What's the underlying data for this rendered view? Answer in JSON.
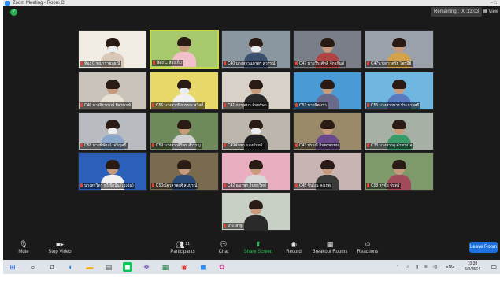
{
  "window": {
    "title": "Zoom Meeting - Room C",
    "controls": "–  □"
  },
  "header": {
    "remaining": "Remaining : 00:13:03",
    "view_label": "View"
  },
  "tiles": [
    {
      "label": "ห้อง C พญาราชภูธณี",
      "bg": "#f1ede4",
      "body": "#d9c7b8",
      "mask": true
    },
    {
      "label": "ห้อง C ห้องเก็บ",
      "bg": "#a8c86e",
      "body": "#f2c0c8",
      "mask": false,
      "active": true
    },
    {
      "label": "C40 นางสาวนภาพร สุวรรณ์",
      "bg": "#8a96a0",
      "body": "#3b4f6e",
      "mask": true
    },
    {
      "label": "C47 นายวีระศักดิ์ จักรกันต์",
      "bg": "#7a7e88",
      "body": "#b04444",
      "mask": false
    },
    {
      "label": "C47นางสาวศรัย ไพรมีย์",
      "bg": "#9aa1ab",
      "body": "#d4a24a",
      "mask": false
    },
    {
      "label": "C46 นางจิราภรณ์ มิตรนนท์",
      "bg": "#c9c3bb",
      "body": "#e8dfd5",
      "mask": false
    },
    {
      "label": "C56 นางสาวปิยวรรณ สวัสดิ์",
      "bg": "#e8d86a",
      "body": "#f0f0f0",
      "mask": true
    },
    {
      "label": "C41 กาญจนา จันทร์ษา",
      "bg": "#d7d1c8",
      "body": "#2a2a2a",
      "mask": false
    },
    {
      "label": "C53 นายจิตนรา",
      "bg": "#4a9ad6",
      "body": "#6a6a8a",
      "mask": false
    },
    {
      "label": "C55 นางสาวนาง ประกายศรี",
      "bg": "#6fb6e0",
      "body": "#5a7ac0",
      "mask": false
    },
    {
      "label": "C58 นายพิพัฒน์ เจริญศรี",
      "bg": "#b8bcc0",
      "body": "#8aa6c8",
      "mask": true
    },
    {
      "label": "C59 นางสาวศิริพร สำราญ",
      "bg": "#6e8a5a",
      "body": "#cfcfcf",
      "mask": false
    },
    {
      "label": "C49พัชชา แสงจันทร์",
      "bg": "#bdb6ac",
      "body": "#202020",
      "mask": true
    },
    {
      "label": "C43 ปราณี อินทรพรหม",
      "bg": "#9a8a6a",
      "body": "#6a4a8a",
      "mask": false
    },
    {
      "label": "C33 นางสาวสุ คำพวงใจ",
      "bg": "#a6b0a4",
      "body": "#3a9a6a",
      "mask": false
    },
    {
      "label": "นางสาวิดา หงีเยียปัน (เอเฉ่น)",
      "bg": "#2c5fb8",
      "body": "#f0f0f0",
      "mask": false
    },
    {
      "label": "C50ณัฐวลาพงศ์ สมบูรณ์",
      "bg": "#7a6a4e",
      "body": "#2a4a7a",
      "mask": false
    },
    {
      "label": "C42 ฉมาพร อินทรวิทย์",
      "bg": "#e9aec0",
      "body": "#d8d8d8",
      "mask": false
    },
    {
      "label": "C45 ชินโณ คงเกตุ",
      "bg": "#c9b4b4",
      "body": "#3a3a3a",
      "mask": false
    },
    {
      "label": "C58 สุรชัย จันทร์",
      "bg": "#7e9a6a",
      "body": "#a04a5a",
      "mask": false
    },
    {
      "label": "ประเสริฐ",
      "bg": "#c8cfc4",
      "body": "#2a2a2a",
      "mask": false
    }
  ],
  "toolbar": {
    "mute": "Mute",
    "stop_video": "Stop Video",
    "participants": "Participants",
    "participants_count": "21",
    "chat": "Chat",
    "share_screen": "Share Screen",
    "record": "Record",
    "breakout_rooms": "Breakout Rooms",
    "reactions": "Reactions",
    "leave": "Leave Room"
  },
  "taskbar": {
    "language": "ENG",
    "time": "10:38",
    "date": "5/8/2564"
  },
  "colors": {
    "accent_green": "#23c455",
    "leave_blue": "#1e6fe0",
    "mic_red": "#e0453a"
  }
}
